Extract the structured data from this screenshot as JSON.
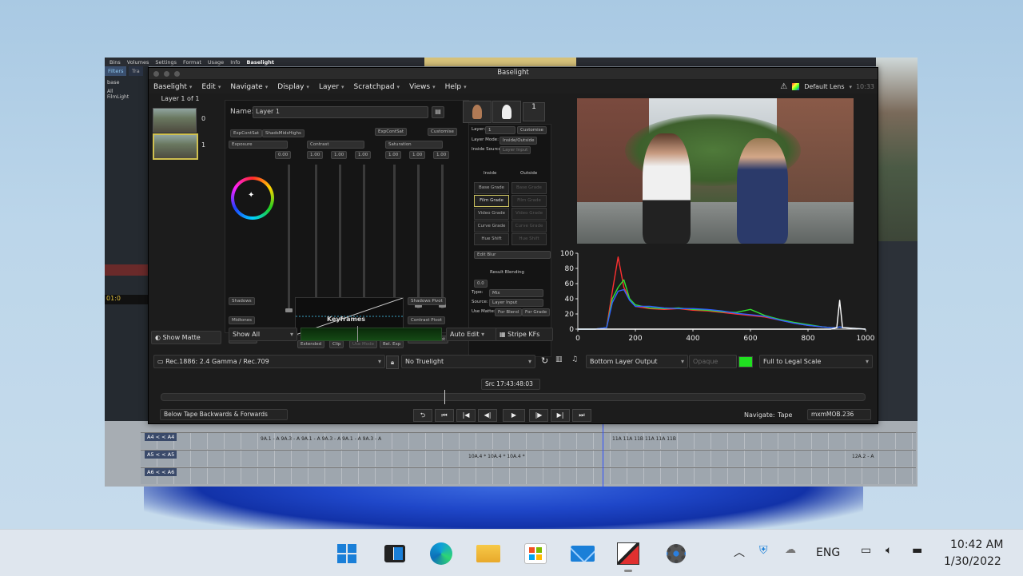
{
  "host_app": {
    "menu": [
      "Bins",
      "Volumes",
      "Settings",
      "Format",
      "Usage",
      "Info"
    ],
    "left_tabs": [
      "Filters",
      "Tra"
    ],
    "left_items": [
      "base",
      "All",
      "FilmLight"
    ],
    "tab_label": "Baselight",
    "timecode_fragment": "01:0",
    "tracks": [
      {
        "label": "A4 <  < A4"
      },
      {
        "label": "A5 <  < A5"
      },
      {
        "label": "A6 <  < A6"
      }
    ],
    "clip_text_a": "9A.1 - A  9A.3 - A  9A.1 - A  9A.3 - A  9A.1 - A  9A.3 - A",
    "clip_text_b": "10A.4 *  10A.4 *  10A.4 *",
    "clip_text_c": "11A  11A  11B  11A  11A  11B",
    "clip_text_d": "12A.2 - A"
  },
  "baselight": {
    "window_title": "Baselight",
    "menu": [
      "Baselight",
      "Edit",
      "Navigate",
      "Display",
      "Layer",
      "Scratchpad",
      "Views",
      "Help"
    ],
    "lens": "Default Lens",
    "time_small": "10:33",
    "layers_header": "Layer 1 of 1",
    "layer_numbers": [
      "0",
      "1"
    ],
    "name_label": "Name:",
    "name_value": "Layer 1",
    "layer_count": "1",
    "tabs_top": [
      "ExpContSat",
      "ShadsMidsHighs",
      "ExpContSat",
      "Customise"
    ],
    "blocks": [
      {
        "title": "Exposure",
        "value": "0.00"
      },
      {
        "title": "Contrast",
        "values": [
          "1.00",
          "1.00",
          "1.00"
        ]
      },
      {
        "title": "Saturation",
        "values": [
          "1.00",
          "1.00",
          "1.00"
        ]
      }
    ],
    "curve_rows_left": [
      "Shadows",
      "Midtones",
      "Highlights"
    ],
    "curve_rows_right": [
      "Shadows Pivot",
      "Contrast Pivot",
      "Highlights Pivot"
    ],
    "curve_buttons": [
      "Extended",
      "Clip",
      "Use Mode",
      "Bel. Exp"
    ],
    "layer_settings": {
      "layer_label": "Layer:",
      "layer_value": "1",
      "customise": "Customise",
      "layer_mode_label": "Layer Mode:",
      "layer_mode_value": "Inside/Outside",
      "inside_source_label": "Inside Source:",
      "inside_source_value": "Layer Input",
      "col_inside": "Inside",
      "col_outside": "Outside",
      "inside_buttons": [
        "Base Grade",
        "Film Grade",
        "Video Grade",
        "Curve Grade",
        "Hue Shift"
      ],
      "outside_buttons": [
        "Base Grade",
        "Film Grade",
        "Video Grade",
        "Curve Grade",
        "Hue Shift"
      ],
      "edit_blur": "Edit Blur",
      "result_blending": "Result Blending",
      "blend_value": "0.0",
      "type_label": "Type:",
      "type_value": "Mix",
      "source_label": "Source:",
      "source_value": "Layer Input",
      "use_matte_label": "Use Matte:",
      "use_matte_a": "For Blend",
      "use_matte_b": "For Grade"
    },
    "show_matte": "Show Matte",
    "keyframes_label": "Keyframes",
    "show_all": "Show All",
    "auto_edit": "Auto Edit",
    "stripe_kfs": "Stripe KFs",
    "display_bar": {
      "colour_space": "Rec.1886: 2.4 Gamma / Rec.709",
      "truelight": "No Truelight",
      "output": "Bottom Layer Output",
      "opaque": "Opaque",
      "scale": "Full to Legal Scale"
    },
    "src_timecode": "Src 17:43:48:03",
    "nav_mode": "Below  Tape  Backwards & Forwards",
    "navigate_label": "Navigate:",
    "navigate_value": "Tape",
    "clip_id": "mxmMOB.236",
    "transport_buttons": [
      "⮌",
      "⏮",
      "|◀",
      "◀|",
      "▶",
      "|▶",
      "▶|",
      "⏭"
    ]
  },
  "chart_data": {
    "type": "line",
    "title": "",
    "xlabel": "",
    "ylabel": "",
    "xlim": [
      0,
      1000
    ],
    "ylim": [
      0,
      100
    ],
    "xticks": [
      0,
      200,
      400,
      600,
      800,
      1000
    ],
    "yticks": [
      0,
      20,
      40,
      60,
      80,
      100
    ],
    "x": [
      0,
      60,
      100,
      120,
      140,
      160,
      180,
      200,
      250,
      300,
      350,
      400,
      450,
      500,
      550,
      600,
      650,
      700,
      750,
      800,
      850,
      880,
      900,
      910,
      920,
      1000
    ],
    "series": [
      {
        "color": "#ff3030",
        "values": [
          0,
          0,
          2,
          50,
          95,
          55,
          40,
          30,
          27,
          26,
          27,
          25,
          24,
          22,
          20,
          18,
          16,
          12,
          8,
          5,
          3,
          2,
          2,
          3,
          2,
          0
        ]
      },
      {
        "color": "#30e030",
        "values": [
          0,
          0,
          2,
          40,
          55,
          65,
          40,
          32,
          28,
          27,
          28,
          26,
          25,
          23,
          22,
          26,
          18,
          13,
          9,
          6,
          3,
          2,
          2,
          3,
          2,
          0
        ]
      },
      {
        "color": "#3060ff",
        "values": [
          0,
          0,
          2,
          35,
          50,
          52,
          38,
          30,
          30,
          28,
          27,
          27,
          26,
          24,
          21,
          19,
          17,
          12,
          8,
          5,
          3,
          2,
          2,
          3,
          2,
          0
        ]
      },
      {
        "color": "#ffffff",
        "values": [
          0,
          0,
          0,
          0,
          0,
          0,
          0,
          0,
          0,
          0,
          0,
          0,
          0,
          0,
          0,
          0,
          0,
          0,
          0,
          0,
          0,
          0,
          2,
          38,
          2,
          0
        ]
      }
    ]
  },
  "taskbar": {
    "icons": [
      "windows-start-icon",
      "task-view-icon",
      "edge-icon",
      "file-explorer-icon",
      "store-icon",
      "mail-icon",
      "baselight-app-icon",
      "settings-icon"
    ],
    "language": "ENG",
    "time": "10:42 AM",
    "date": "1/30/2022"
  },
  "colors": {
    "desktop_bg": "#b6d1e8",
    "baselight_bg": "#1c1c1c",
    "accent_yellow": "#d0c050",
    "active_green": "#20e020"
  }
}
